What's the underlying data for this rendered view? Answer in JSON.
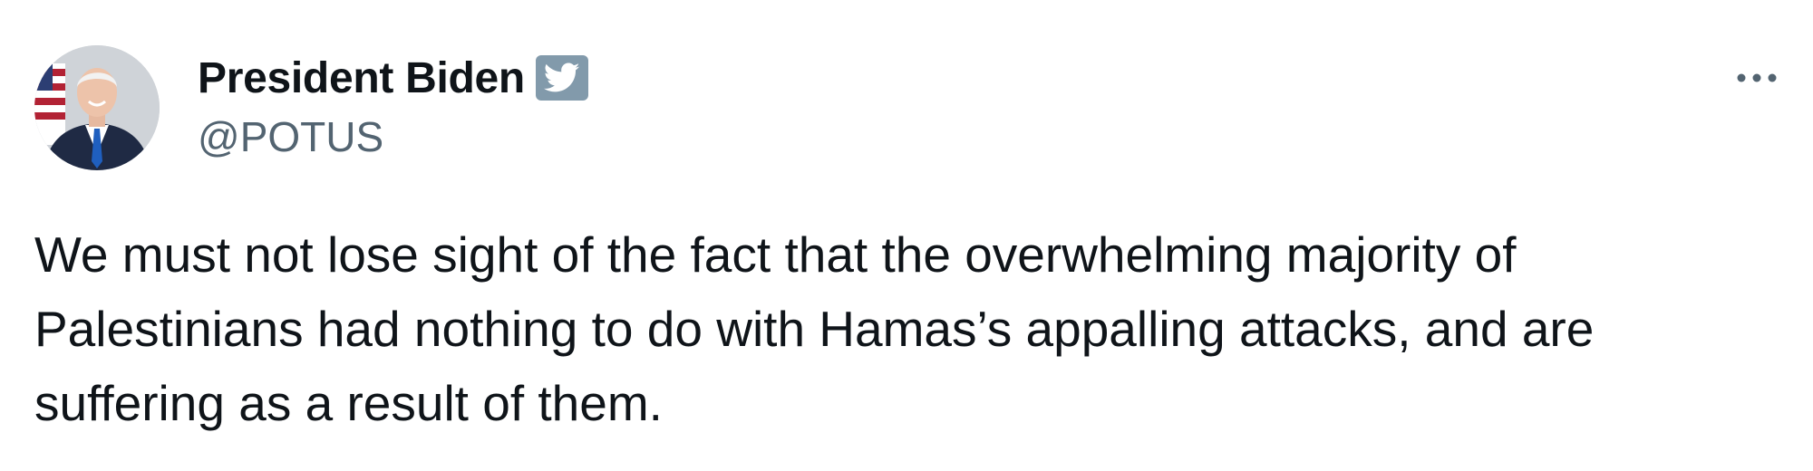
{
  "author": {
    "display_name": "President Biden",
    "handle": "@POTUS",
    "avatar_icon": "president-portrait-avatar",
    "badge_icon": "government-verified-badge-icon",
    "badge_color": "#829aab"
  },
  "tweet": {
    "text_lines": [
      "We must not lose sight of the fact that the overwhelming majority of",
      "Palestinians had nothing to do with Hamas’s appalling attacks, and are",
      "suffering as a result of them."
    ]
  },
  "menu": {
    "icon": "more-options-icon"
  },
  "colors": {
    "text_primary": "#0f1419",
    "text_secondary": "#536471",
    "background": "#ffffff"
  }
}
